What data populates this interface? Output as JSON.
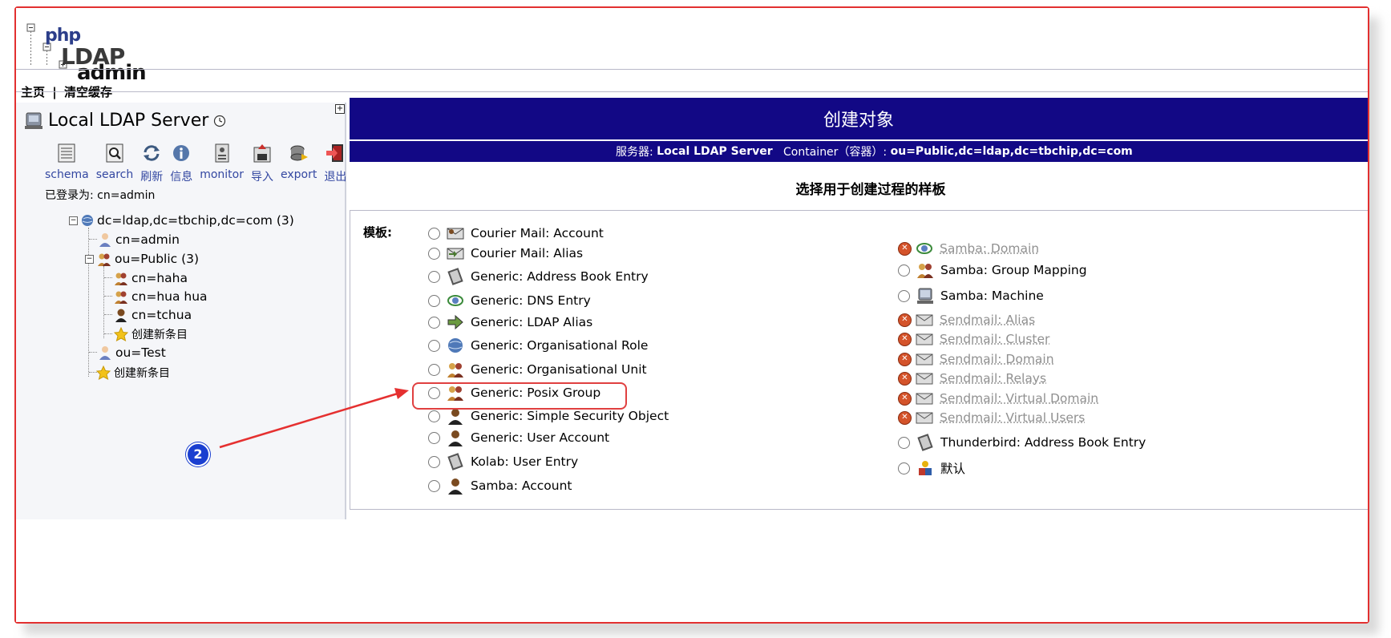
{
  "logo": {
    "php": "php",
    "ldap": "LDAP",
    "admin": "admin"
  },
  "topnav": {
    "home": "主页",
    "sep": "|",
    "purge": "清空缓存"
  },
  "expand_symbol": "+",
  "server": {
    "name": "Local LDAP Server",
    "logged_in": "已登录为: cn=admin"
  },
  "toolbar": [
    {
      "label": "schema",
      "icon": "schema-icon"
    },
    {
      "label": "search",
      "icon": "search-icon"
    },
    {
      "label": "刷新",
      "icon": "refresh-icon"
    },
    {
      "label": "信息",
      "icon": "info-icon"
    },
    {
      "label": "monitor",
      "icon": "monitor-icon"
    },
    {
      "label": "导入",
      "icon": "import-icon"
    },
    {
      "label": "export",
      "icon": "export-icon"
    },
    {
      "label": "退出",
      "icon": "logout-icon"
    }
  ],
  "tree": {
    "root": "dc=ldap,dc=tbchip,dc=com (3)",
    "admin": "cn=admin",
    "public": "ou=Public (3)",
    "haha": "cn=haha",
    "huahua": "cn=hua hua",
    "tchua": "cn=tchua",
    "create_inner": "创建新条目",
    "test": "ou=Test",
    "create_outer": "创建新条目",
    "toggle_minus": "−"
  },
  "main": {
    "title": "创建对象",
    "subtitle_server_label": "服务器:",
    "subtitle_server": "Local LDAP Server",
    "subtitle_container_label": "Container（容器）:",
    "subtitle_container": "ou=Public,dc=ldap,dc=tbchip,dc=com",
    "section_title": "选择用于创建过程的样板",
    "template_label": "模板:"
  },
  "templates_left": [
    {
      "label": "Courier Mail: Account",
      "icon": "mail-account-icon"
    },
    {
      "label": "Courier Mail: Alias",
      "icon": "mail-alias-icon"
    },
    {
      "label": "Generic: Address Book Entry",
      "icon": "address-book-icon"
    },
    {
      "label": "Generic: DNS Entry",
      "icon": "dns-icon"
    },
    {
      "label": "Generic: LDAP Alias",
      "icon": "alias-arrow-icon"
    },
    {
      "label": "Generic: Organisational Role",
      "icon": "globe-icon"
    },
    {
      "label": "Generic: Organisational Unit",
      "icon": "ou-icon"
    },
    {
      "label": "Generic: Posix Group",
      "icon": "group-icon"
    },
    {
      "label": "Generic: Simple Security Object",
      "icon": "user-icon"
    },
    {
      "label": "Generic: User Account",
      "icon": "user-icon"
    },
    {
      "label": "Kolab: User Entry",
      "icon": "address-book-icon"
    },
    {
      "label": "Samba: Account",
      "icon": "user-icon"
    }
  ],
  "templates_right": [
    {
      "label": "Samba: Domain",
      "icon": "dns-icon",
      "disabled": true
    },
    {
      "label": "Samba: Group Mapping",
      "icon": "group-icon",
      "disabled": false
    },
    {
      "label": "Samba: Machine",
      "icon": "computer-icon",
      "disabled": false
    },
    {
      "label": "Sendmail: Alias",
      "icon": "mail-icon",
      "disabled": true
    },
    {
      "label": "Sendmail: Cluster",
      "icon": "mail-icon",
      "disabled": true
    },
    {
      "label": "Sendmail: Domain",
      "icon": "mail-icon",
      "disabled": true
    },
    {
      "label": "Sendmail: Relays",
      "icon": "mail-icon",
      "disabled": true
    },
    {
      "label": "Sendmail: Virtual Domain",
      "icon": "mail-icon",
      "disabled": true
    },
    {
      "label": "Sendmail: Virtual Users",
      "icon": "mail-icon",
      "disabled": true
    },
    {
      "label": "Thunderbird: Address Book Entry",
      "icon": "address-book-icon",
      "disabled": false
    },
    {
      "label": "默认",
      "icon": "default-icon",
      "disabled": false
    }
  ],
  "annotation": {
    "badge": "2"
  },
  "colors": {
    "header_bg": "#120885",
    "highlight": "#e04040",
    "badge": "#1a3fd0",
    "link": "#3347a1"
  }
}
